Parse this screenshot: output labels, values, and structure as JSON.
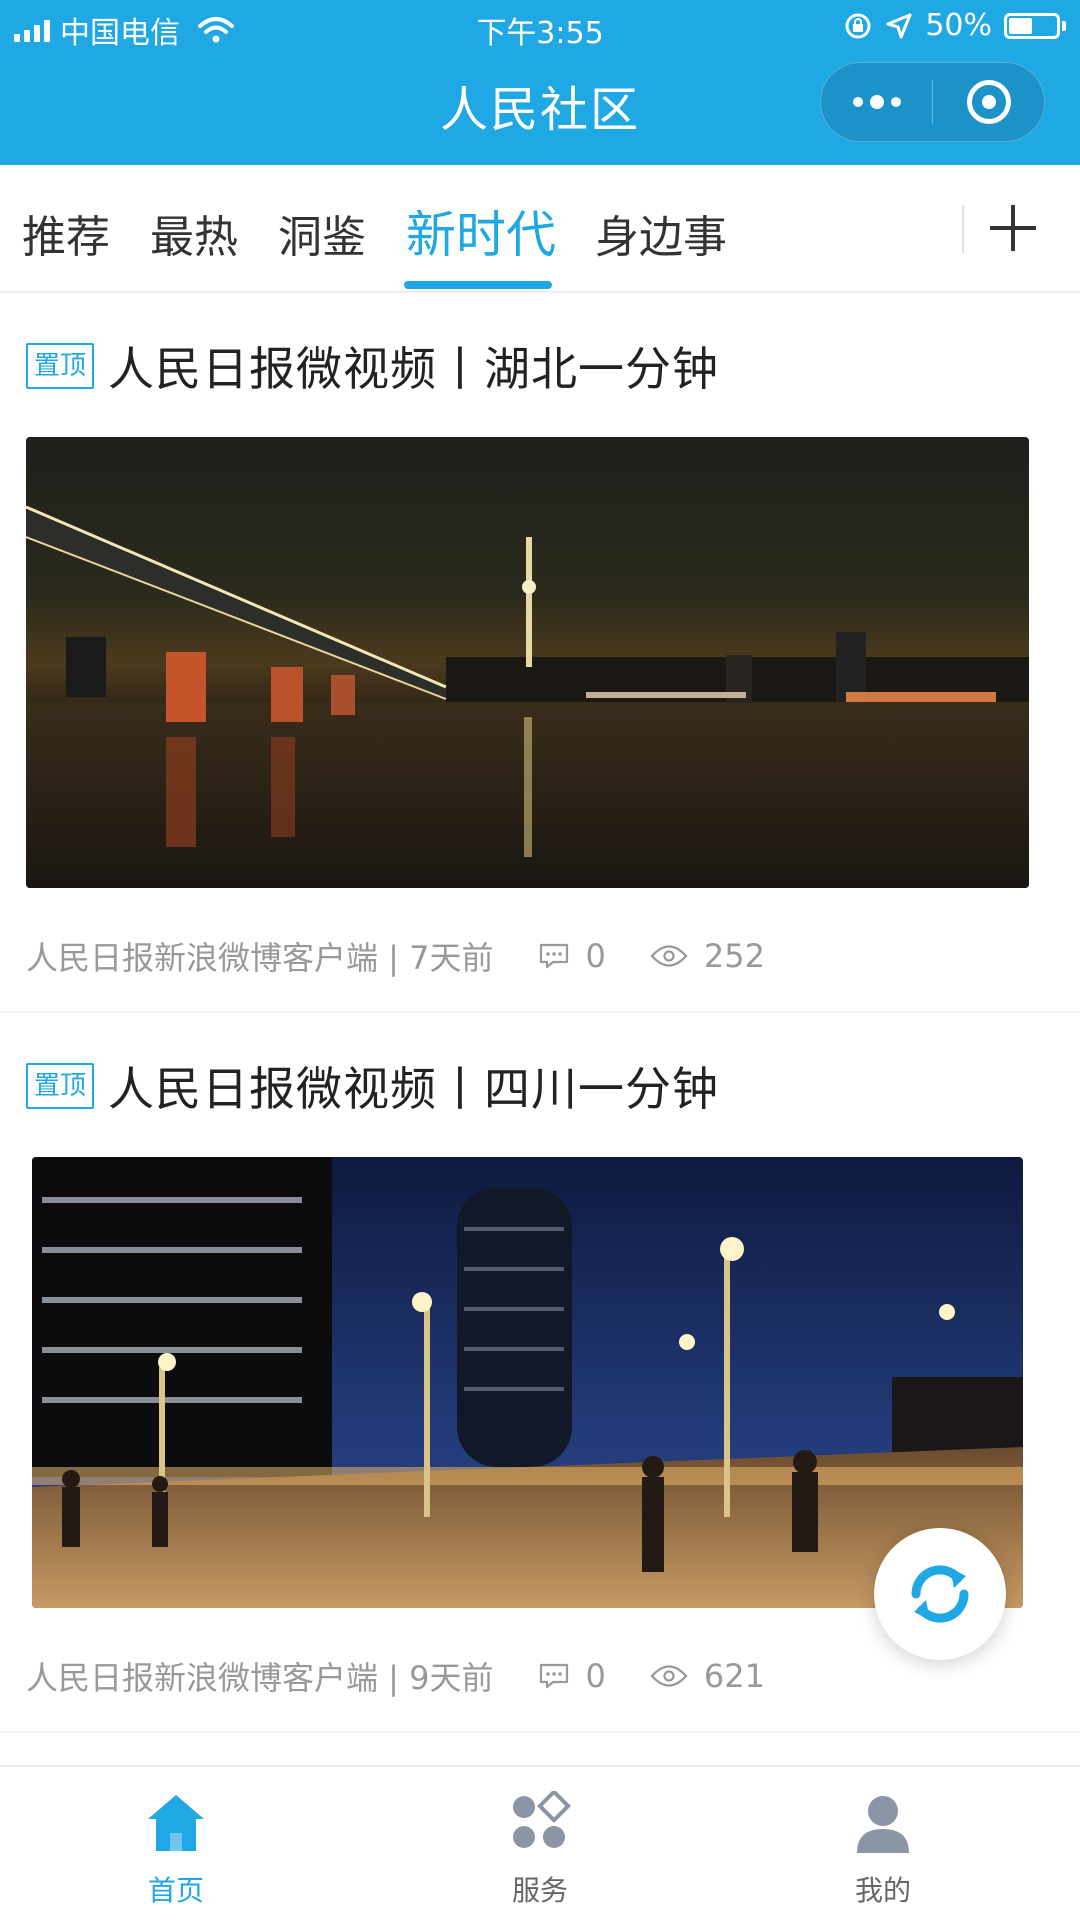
{
  "status_bar": {
    "carrier": "中国电信",
    "time": "下午3:55",
    "battery_percent": "50%",
    "battery_level": 0.5,
    "icons": [
      "signal-icon",
      "wifi-icon",
      "rotation-lock-icon",
      "location-arrow-icon",
      "battery-icon"
    ]
  },
  "header": {
    "title": "人民社区",
    "capsule_icons": [
      "more-dots-icon",
      "close-target-icon"
    ]
  },
  "tabs": {
    "items": [
      "推荐",
      "最热",
      "洞鉴",
      "新时代",
      "身边事"
    ],
    "active": "新时代",
    "add_icon": "plus-icon"
  },
  "articles": [
    {
      "badge": "置顶",
      "title": "人民日报微视频丨湖北一分钟",
      "source_time": "人民日报新浪微博客户端 | 7天前",
      "comments": "0",
      "views": "252",
      "image": "night bridge over river with illuminated tower"
    },
    {
      "badge": "置顶",
      "title": "人民日报微视频丨四川一分钟",
      "source_time": "人民日报新浪微博客户端 | 9天前",
      "comments": "0",
      "views": "621",
      "image": "city street at night with tall buildings and pedestrians"
    }
  ],
  "floating": {
    "icon": "refresh-icon"
  },
  "bottom_nav": {
    "items": [
      {
        "label": "首页",
        "icon": "home-icon",
        "active": true
      },
      {
        "label": "服务",
        "icon": "services-icon",
        "active": false
      },
      {
        "label": "我的",
        "icon": "profile-icon",
        "active": false
      }
    ]
  },
  "colors": {
    "accent": "#1fa8e4",
    "meta_text": "#999999",
    "title_text": "#222222"
  }
}
